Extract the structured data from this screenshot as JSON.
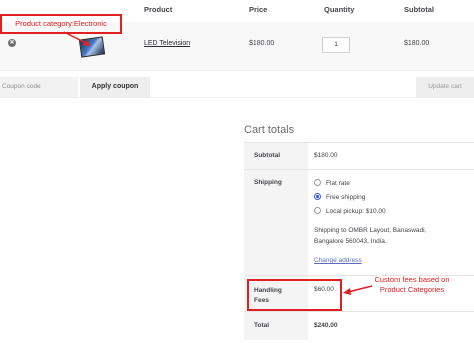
{
  "table_header": {
    "product": "Product",
    "price": "Price",
    "quantity": "Quantity",
    "subtotal": "Subtotal"
  },
  "cart_item": {
    "remove_icon": "close-icon",
    "product_name": "LED Television",
    "price": "$180.00",
    "quantity": "1",
    "subtotal": "$180.00"
  },
  "actions": {
    "coupon_placeholder": "Coupon code",
    "apply_label": "Apply coupon",
    "update_label": "Update cart"
  },
  "cart_totals": {
    "title": "Cart totals",
    "subtotal_label": "Subtotal",
    "subtotal_value": "$180.00",
    "shipping_label": "Shipping",
    "shipping_options": [
      {
        "label": "Flat rate",
        "selected": false
      },
      {
        "label": "Free shipping",
        "selected": true
      },
      {
        "label": "Local pickup: $10.00",
        "selected": false
      }
    ],
    "shipping_to_line1": "Shipping to OMBR Layout, Banaswadi,",
    "shipping_to_line2": "Bangalore 560043, India.",
    "change_address": "Change address",
    "fees_label_line1": "Handling",
    "fees_label_line2": "Fees",
    "fees_value": "$60.00",
    "total_label": "Total",
    "total_value": "$240.00"
  },
  "annotations": {
    "product_category": "Product category:Electronic",
    "custom_fees_line1": "Custom fees based on",
    "custom_fees_line2": "Product Categories",
    "color": "#e02020"
  }
}
